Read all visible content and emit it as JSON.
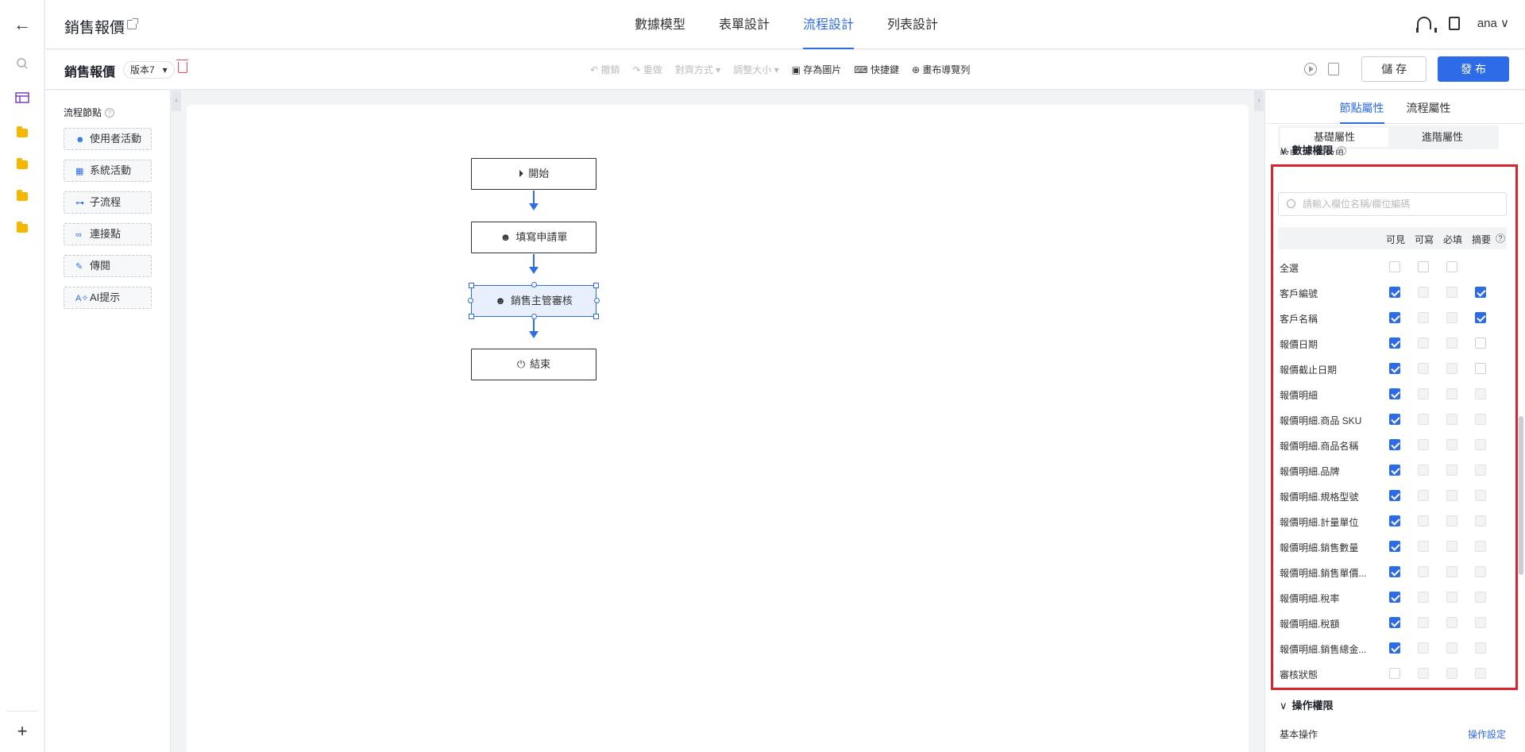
{
  "app": {
    "title": "銷售報價"
  },
  "nav_tabs": [
    {
      "label": "數據模型"
    },
    {
      "label": "表單設計"
    },
    {
      "label": "流程設計"
    },
    {
      "label": "列表設計"
    }
  ],
  "user": {
    "name": "ana"
  },
  "toolbar": {
    "doc_title": "銷售報價",
    "version": "版本7",
    "undo": "撤銷",
    "redo": "重做",
    "align": "對齊方式",
    "resize": "調整大小",
    "save_image": "存為圖片",
    "shortcuts": "快捷鍵",
    "canvas_nav": "畫布導覽列",
    "save_label": "儲 存",
    "publish_label": "發 布"
  },
  "palette": {
    "title": "流程節點",
    "items": [
      {
        "label": "使用者活動",
        "icon": "user-icon"
      },
      {
        "label": "系統活動",
        "icon": "grid-icon"
      },
      {
        "label": "子流程",
        "icon": "subflow-icon"
      },
      {
        "label": "連接點",
        "icon": "link-icon"
      },
      {
        "label": "傳閱",
        "icon": "circulate-icon"
      },
      {
        "label": "AI提示",
        "icon": "ai-icon"
      }
    ]
  },
  "flow": {
    "nodes": [
      {
        "label": "開始",
        "icon": "play-circle-icon"
      },
      {
        "label": "填寫申請單",
        "icon": "user-icon"
      },
      {
        "label": "銷售主管審核",
        "icon": "user-icon",
        "selected": true
      },
      {
        "label": "結束",
        "icon": "power-icon"
      }
    ]
  },
  "panel": {
    "tabs": [
      {
        "label": "節點屬性"
      },
      {
        "label": "流程屬性"
      }
    ],
    "sub_tabs": [
      {
        "label": "基礎屬性"
      },
      {
        "label": "進階屬性"
      }
    ],
    "radio": {
      "enabled": "啟用",
      "disabled": "不啟用",
      "selected": "不啟用"
    },
    "data_perm": {
      "title": "數據權限",
      "search_placeholder": "請輸入欄位名稱/欄位編碼",
      "columns": [
        "可見",
        "可寫",
        "必填",
        "摘要"
      ],
      "rows": [
        {
          "label": "全選",
          "visible": false,
          "writable": false,
          "required": false,
          "summary": null
        },
        {
          "label": "客戶編號",
          "visible": true,
          "writable": false,
          "required": false,
          "summary": true
        },
        {
          "label": "客戶名稱",
          "visible": true,
          "writable": false,
          "required": false,
          "summary": true
        },
        {
          "label": "報價日期",
          "visible": true,
          "writable": false,
          "required": false,
          "summary": false
        },
        {
          "label": "報價截止日期",
          "visible": true,
          "writable": false,
          "required": false,
          "summary": false
        },
        {
          "label": "報價明細",
          "visible": true,
          "writable": false,
          "required": false,
          "summary": false
        },
        {
          "label": "報價明細.商品 SKU",
          "visible": true,
          "writable": false,
          "required": false,
          "summary": false
        },
        {
          "label": "報價明細.商品名稱",
          "visible": true,
          "writable": false,
          "required": false,
          "summary": false
        },
        {
          "label": "報價明細.品牌",
          "visible": true,
          "writable": false,
          "required": false,
          "summary": false
        },
        {
          "label": "報價明細.規格型號",
          "visible": true,
          "writable": false,
          "required": false,
          "summary": false
        },
        {
          "label": "報價明細.計量單位",
          "visible": true,
          "writable": false,
          "required": false,
          "summary": false
        },
        {
          "label": "報價明細.銷售數量",
          "visible": true,
          "writable": false,
          "required": false,
          "summary": false
        },
        {
          "label": "報價明細.銷售單價...",
          "visible": true,
          "writable": false,
          "required": false,
          "summary": false
        },
        {
          "label": "報價明細.稅率",
          "visible": true,
          "writable": false,
          "required": false,
          "summary": false
        },
        {
          "label": "報價明細.稅額",
          "visible": true,
          "writable": false,
          "required": false,
          "summary": false
        },
        {
          "label": "報價明細.銷售總金...",
          "visible": true,
          "writable": false,
          "required": false,
          "summary": false
        },
        {
          "label": "審核狀態",
          "visible": false,
          "writable": false,
          "required": false,
          "summary": false
        }
      ]
    },
    "op_perm": {
      "title": "操作權限",
      "basic_label": "基本操作",
      "settings_link": "操作設定"
    }
  },
  "colors": {
    "accent": "#2e6be6",
    "highlight": "#d9232d"
  }
}
